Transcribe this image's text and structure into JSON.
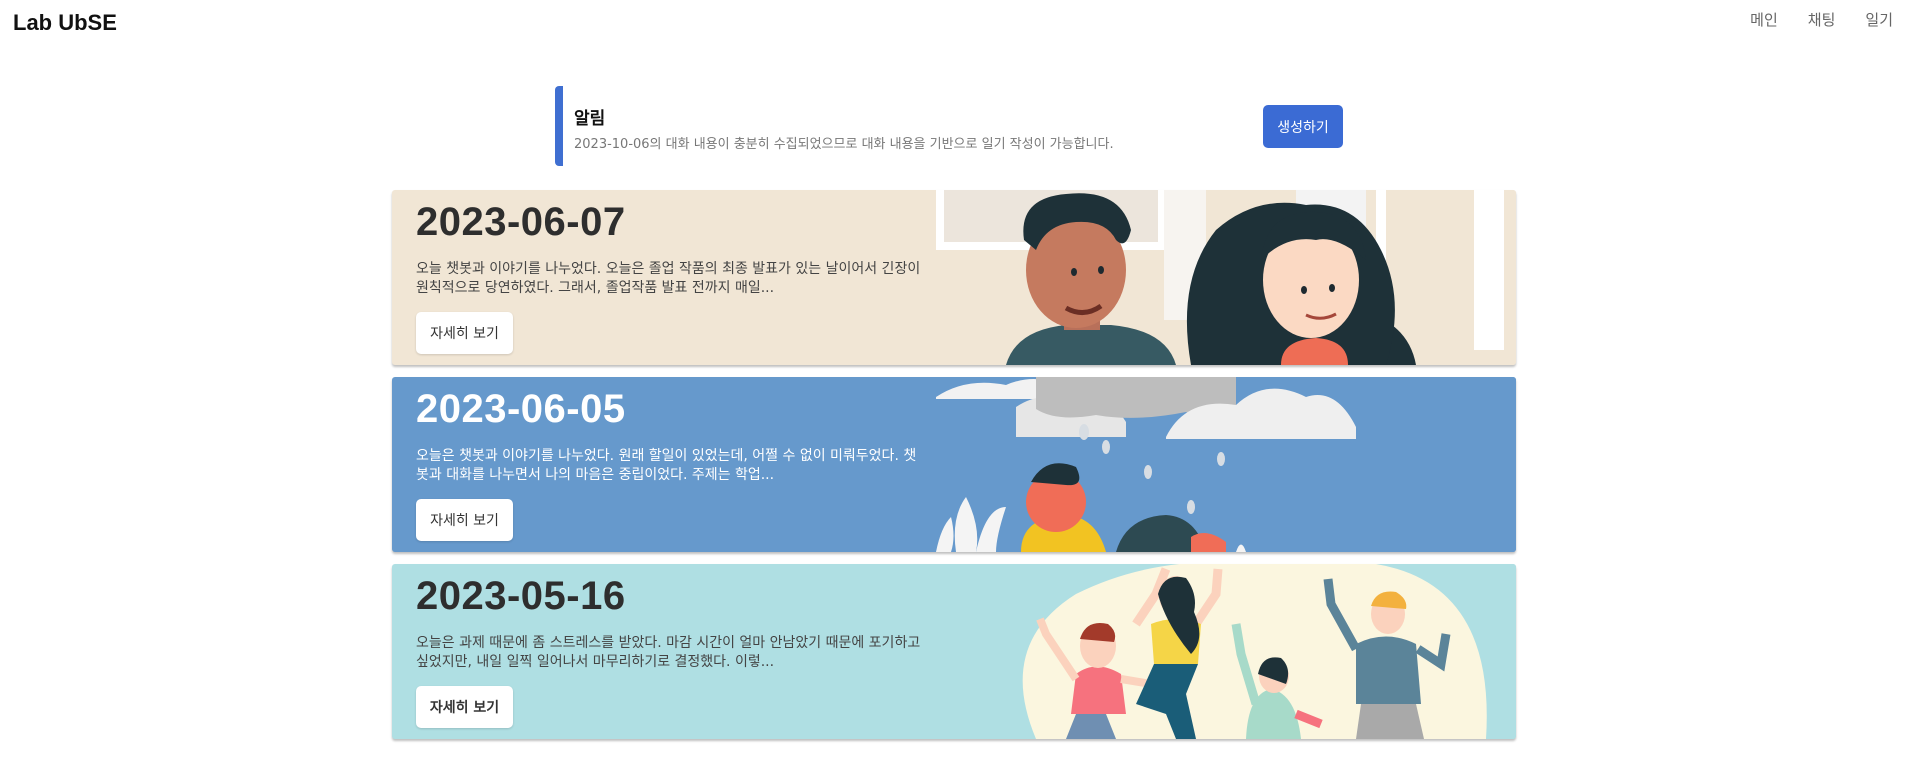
{
  "app": {
    "brand": "Lab UbSE"
  },
  "nav": {
    "items": [
      {
        "label": "메인"
      },
      {
        "label": "채팅"
      },
      {
        "label": "일기"
      }
    ]
  },
  "alert": {
    "title": "알림",
    "message": "2023-10-06의 대화 내용이 충분히 수집되었으므로 대화 내용을 기반으로 일기 작성이 가능합니다.",
    "button_label": "생성하기"
  },
  "diaries": [
    {
      "date": "2023-06-07",
      "excerpt": "오늘 챗봇과 이야기를 나누었다. 오늘은 졸업 작품의 최종 발표가 있는 날이어서 긴장이 원칙적으로 당연하였다. 그래서, 졸업작품 발표 전까지 매일...",
      "button_label": "자세히 보기",
      "illustration": "two-people-illustration",
      "background": "#f1e6d5"
    },
    {
      "date": "2023-06-05",
      "excerpt": "오늘은 챗봇과 이야기를 나누었다. 원래 할일이 있었는데, 어쩔 수 없이 미뤄두었다. 챗봇과 대화를 나누면서 나의 마음은 중립이었다. 주제는 학업...",
      "button_label": "자세히 보기",
      "illustration": "rain-cloud-illustration",
      "background": "#6699cc"
    },
    {
      "date": "2023-05-16",
      "excerpt": "오늘은 과제 때문에 좀 스트레스를 받았다. 마감 시간이 얼마 안남았기 때문에 포기하고 싶었지만, 내일 일찍 일어나서 마무리하기로 결정했다. 이렇...",
      "button_label": "자세히 보기",
      "illustration": "celebrating-people-illustration",
      "background": "#afdfe3"
    }
  ]
}
